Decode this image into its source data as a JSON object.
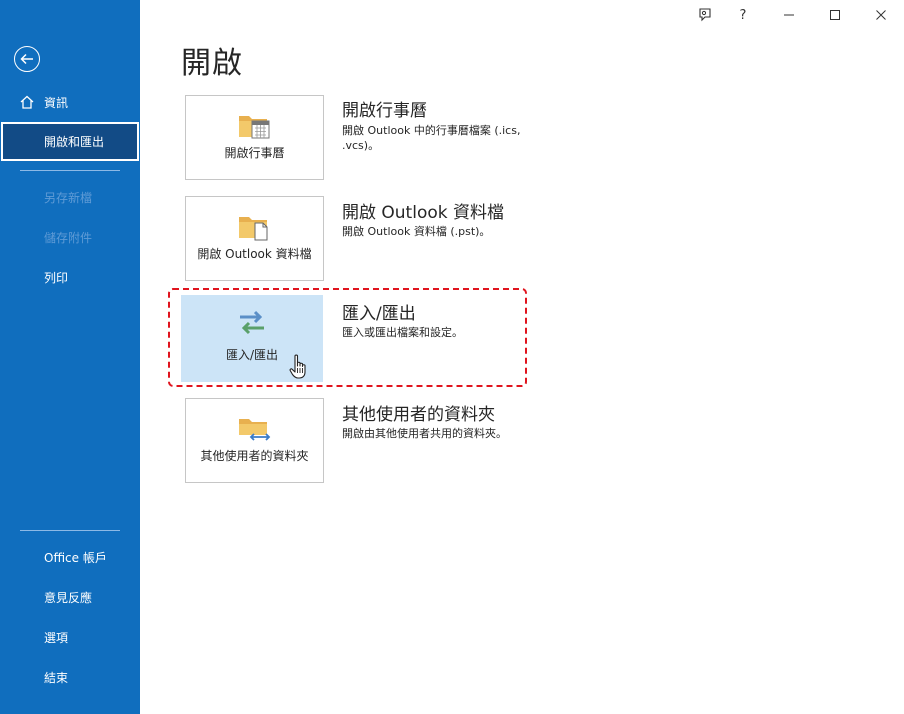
{
  "page_title": "開啟",
  "sidebar": {
    "items": [
      {
        "label": "資訊",
        "state": "normal"
      },
      {
        "label": "開啟和匯出",
        "state": "selected"
      },
      {
        "label": "另存新檔",
        "state": "disabled"
      },
      {
        "label": "儲存附件",
        "state": "disabled"
      },
      {
        "label": "列印",
        "state": "normal"
      },
      {
        "label": "Office 帳戶",
        "state": "normal"
      },
      {
        "label": "意見反應",
        "state": "normal"
      },
      {
        "label": "選項",
        "state": "normal"
      },
      {
        "label": "結束",
        "state": "normal"
      }
    ]
  },
  "window_controls": {
    "help": "?"
  },
  "options": [
    {
      "tile_label": "開啟行事曆",
      "title": "開啟行事曆",
      "desc": "開啟 Outlook 中的行事曆檔案 (.ics, .vcs)。",
      "icon": "folder-calendar-icon"
    },
    {
      "tile_label": "開啟 Outlook 資料檔",
      "title": "開啟 Outlook 資料檔",
      "desc": "開啟 Outlook 資料檔 (.pst)。",
      "icon": "folder-document-icon"
    },
    {
      "tile_label": "匯入/匯出",
      "title": "匯入/匯出",
      "desc": "匯入或匯出檔案和設定。",
      "icon": "import-export-arrows-icon"
    },
    {
      "tile_label": "其他使用者的資料夾",
      "title": "其他使用者的資料夾",
      "desc": "開啟由其他使用者共用的資料夾。",
      "icon": "folder-shared-icon"
    }
  ],
  "colors": {
    "sidebar": "#106ebe",
    "selected_tile": "#cce4f7",
    "highlight": "#e0141e"
  }
}
